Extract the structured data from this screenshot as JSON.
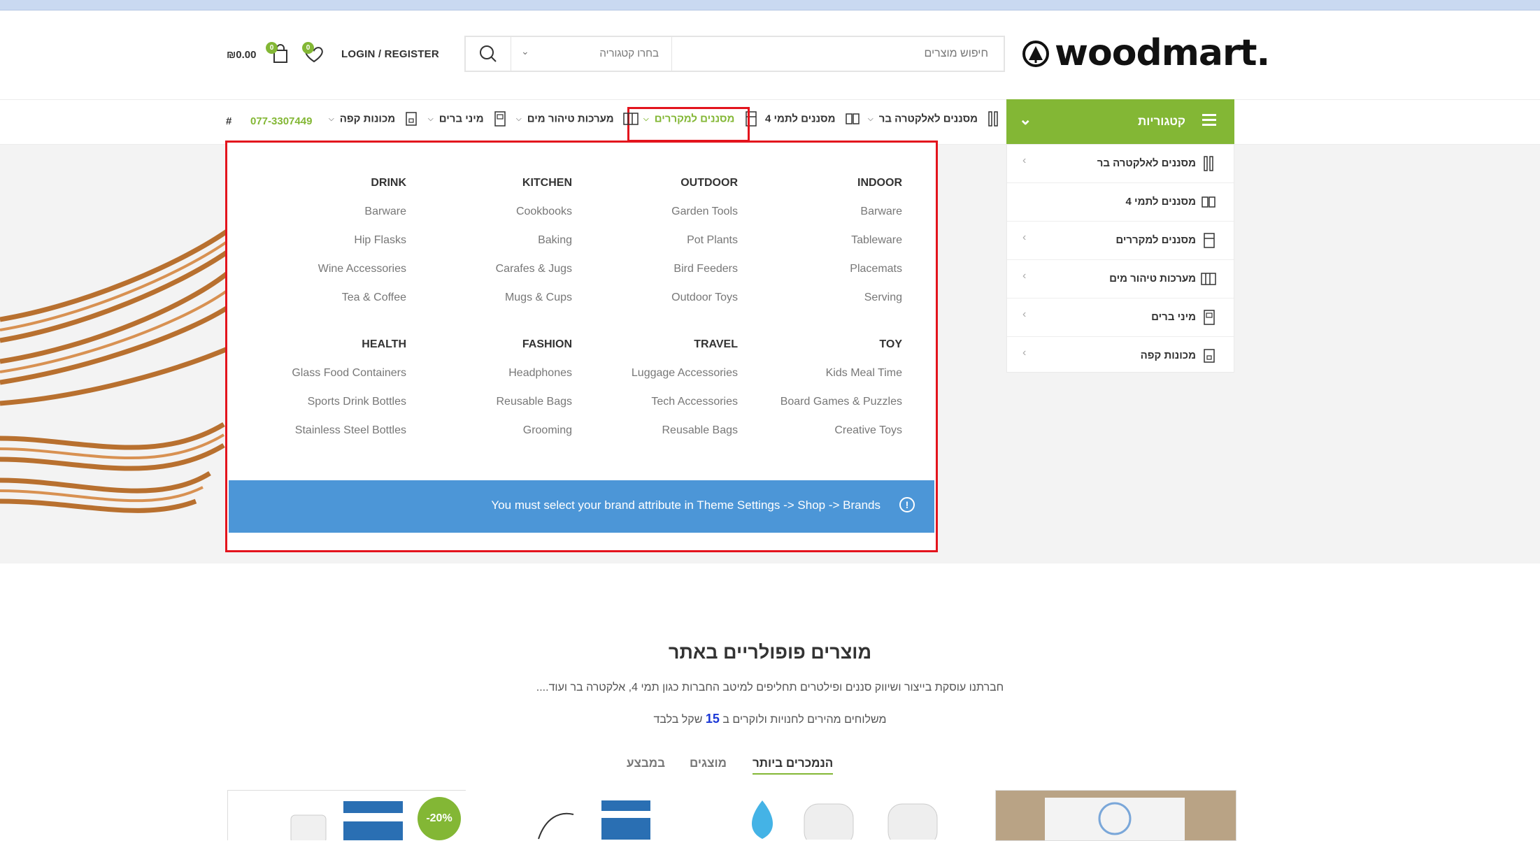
{
  "header": {
    "logo_text": "woodmart.",
    "search_placeholder": "חיפוש מוצרים",
    "search_category": "בחרו קטגוריה",
    "login_label": "LOGIN / REGISTER",
    "wishlist_count": "0",
    "cart_count": "0",
    "cart_total": "₪0.00"
  },
  "nav": {
    "categories_label": "קטגוריות",
    "items": [
      {
        "label": "מסננים לאלקטרה בר"
      },
      {
        "label": "מסננים לתמי 4"
      },
      {
        "label": "מסננים למקררים"
      },
      {
        "label": "מערכות טיהור מים"
      },
      {
        "label": "מיני ברים"
      },
      {
        "label": "מכונות קפה"
      }
    ],
    "phone": "077-3307449",
    "hash": "#"
  },
  "sidebar_categories": [
    {
      "label": "מסננים לאלקטרה בר"
    },
    {
      "label": "מסננים לתמי 4"
    },
    {
      "label": "מסננים למקררים"
    },
    {
      "label": "מערכות טיהור מים"
    },
    {
      "label": "מיני ברים"
    },
    {
      "label": "מכונות קפה"
    }
  ],
  "mega_menu": {
    "columns": [
      {
        "title": "INDOOR",
        "items": [
          "Barware",
          "Tableware",
          "Placemats",
          "Serving"
        ]
      },
      {
        "title": "OUTDOOR",
        "items": [
          "Garden Tools",
          "Pot Plants",
          "Bird Feeders",
          "Outdoor Toys"
        ]
      },
      {
        "title": "KITCHEN",
        "items": [
          "Cookbooks",
          "Baking",
          "Carafes & Jugs",
          "Mugs & Cups"
        ]
      },
      {
        "title": "DRINK",
        "items": [
          "Barware",
          "Hip Flasks",
          "Wine Accessories",
          "Tea & Coffee"
        ]
      },
      {
        "title": "TOY",
        "items": [
          "Kids Meal Time",
          "Board Games & Puzzles",
          "Creative Toys"
        ]
      },
      {
        "title": "TRAVEL",
        "items": [
          "Luggage Accessories",
          "Tech Accessories",
          "Reusable Bags"
        ]
      },
      {
        "title": "FASHION",
        "items": [
          "Headphones",
          "Reusable Bags",
          "Grooming"
        ]
      },
      {
        "title": "HEALTH",
        "items": [
          "Glass Food Containers",
          "Sports Drink Bottles",
          "Stainless Steel Bottles"
        ]
      }
    ],
    "notice": "You must select your brand attribute in Theme Settings -> Shop -> Brands",
    "notice_icon": "!"
  },
  "section": {
    "title": "מוצרים פופולריים באתר",
    "subtitle": "חברתנו עוסקת בייצור ושיווק סננים ופילטרים תחליפים למיטב החברות כגון תמי 4, אלקטרה בר ועוד....",
    "shipping_prefix": "משלוחים מהירים לחנויות ולוקרים ב",
    "shipping_number": "15",
    "shipping_suffix": "שקל בלבד",
    "tabs": [
      "הנמכרים ביותר",
      "מוצגים",
      "במבצע"
    ],
    "sale_badge": "-20%"
  },
  "colors": {
    "accent": "#83b735",
    "notice": "#4c96d7",
    "highlight": "#e3141d"
  }
}
